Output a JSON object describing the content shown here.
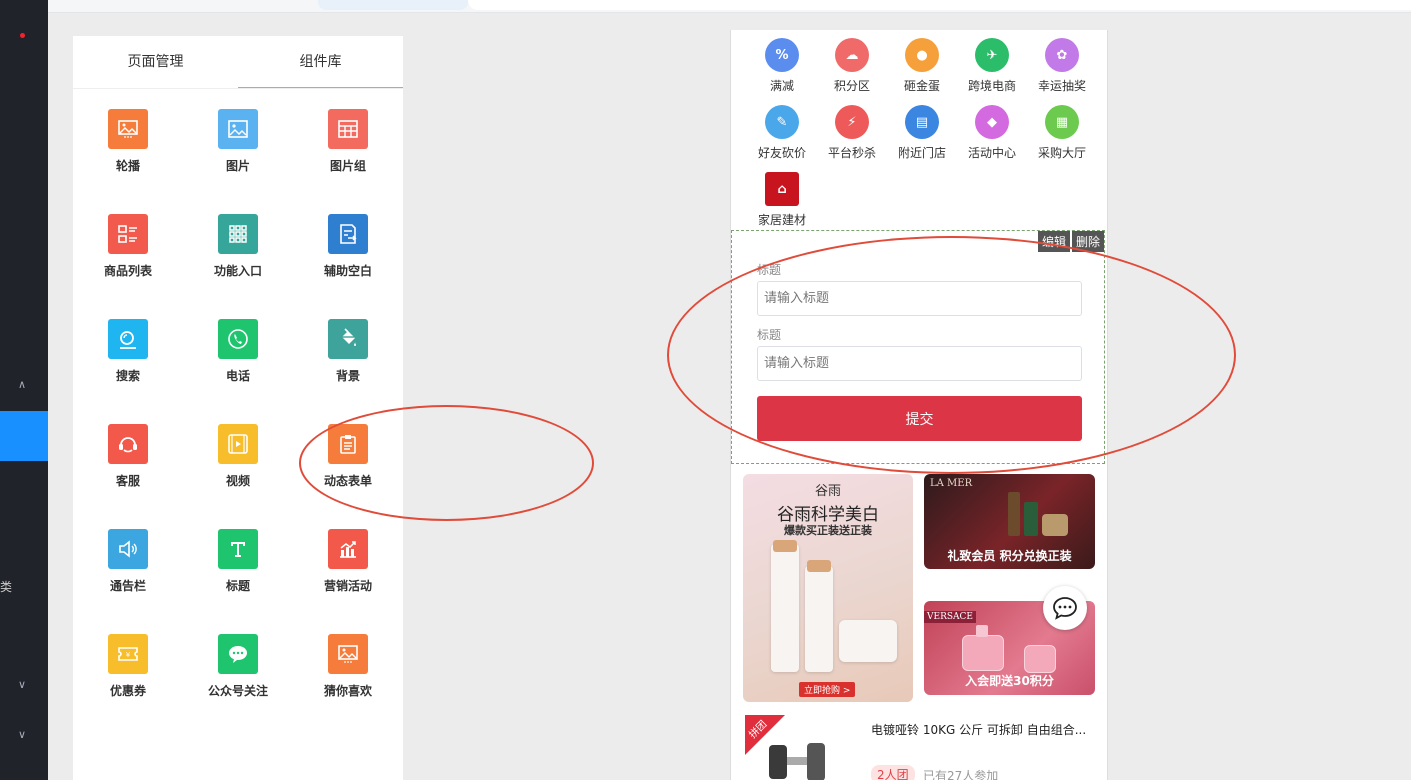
{
  "panel": {
    "tabs": [
      "页面管理",
      "组件库"
    ],
    "components": [
      {
        "label": "轮播",
        "icon": "carousel-icon",
        "color": "#f57c3b"
      },
      {
        "label": "图片",
        "icon": "image-icon",
        "color": "#5ab3f0"
      },
      {
        "label": "图片组",
        "icon": "image-group-icon",
        "color": "#f36b5f"
      },
      {
        "label": "商品列表",
        "icon": "product-list-icon",
        "color": "#f25a4e"
      },
      {
        "label": "功能入口",
        "icon": "grid-entry-icon",
        "color": "#36a69a"
      },
      {
        "label": "辅助空白",
        "icon": "blank-icon",
        "color": "#2f7fd1"
      },
      {
        "label": "搜索",
        "icon": "search-icon",
        "color": "#1eb5f0"
      },
      {
        "label": "电话",
        "icon": "phone-icon",
        "color": "#1ec56e"
      },
      {
        "label": "背景",
        "icon": "paint-bucket-icon",
        "color": "#3ea39b"
      },
      {
        "label": "客服",
        "icon": "headset-icon",
        "color": "#f2594b"
      },
      {
        "label": "视频",
        "icon": "video-icon",
        "color": "#f8bd2a"
      },
      {
        "label": "动态表单",
        "icon": "clipboard-icon",
        "color": "#f57c3b"
      },
      {
        "label": "通告栏",
        "icon": "speaker-icon",
        "color": "#3ba6df"
      },
      {
        "label": "标题",
        "icon": "title-icon",
        "color": "#1ec56e"
      },
      {
        "label": "营销活动",
        "icon": "chart-icon",
        "color": "#f2594b"
      },
      {
        "label": "优惠券",
        "icon": "coupon-icon",
        "color": "#f8bd2a"
      },
      {
        "label": "公众号关注",
        "icon": "wechat-icon",
        "color": "#1ec56e"
      },
      {
        "label": "猜你喜欢",
        "icon": "guess-like-icon",
        "color": "#f57c3b"
      }
    ]
  },
  "phone": {
    "entries": [
      {
        "label": "满减",
        "icon": "discount-icon",
        "color": "#5b8def",
        "glyph": "%"
      },
      {
        "label": "积分区",
        "icon": "points-icon",
        "color": "#f06a6a",
        "glyph": "☁"
      },
      {
        "label": "砸金蛋",
        "icon": "golden-egg-icon",
        "color": "#f5a03a",
        "glyph": "●"
      },
      {
        "label": "跨境电商",
        "icon": "cross-border-icon",
        "color": "#2bbd6a",
        "glyph": "✈"
      },
      {
        "label": "幸运抽奖",
        "icon": "lucky-draw-icon",
        "color": "#c27ae8",
        "glyph": "✿"
      },
      {
        "label": "好友砍价",
        "icon": "bargain-icon",
        "color": "#4aa8ea",
        "glyph": "✎"
      },
      {
        "label": "平台秒杀",
        "icon": "flash-sale-icon",
        "color": "#ee5a5a",
        "glyph": "⚡"
      },
      {
        "label": "附近门店",
        "icon": "store-icon",
        "color": "#3b86e0",
        "glyph": "▤"
      },
      {
        "label": "活动中心",
        "icon": "activity-icon",
        "color": "#d46ae0",
        "glyph": "◆"
      },
      {
        "label": "采购大厅",
        "icon": "purchase-icon",
        "color": "#6cca4e",
        "glyph": "▦"
      },
      {
        "label": "家居建材",
        "icon": "home-building-icon",
        "color": "#c8141f",
        "glyph": "⌂"
      }
    ],
    "form": {
      "edit": "编辑",
      "delete": "删除",
      "fields": [
        {
          "label": "标题",
          "placeholder": "请输入标题"
        },
        {
          "label": "标题",
          "placeholder": "请输入标题"
        }
      ],
      "submit": "提交"
    },
    "banners": {
      "left_brand": "谷雨",
      "left_title": "谷雨科学美白",
      "left_sub": "爆款买正装送正装",
      "left_cta": "立即抢购 >",
      "top_right_brand": "LA MER",
      "top_right": "礼致会员 积分兑换正装",
      "bottom_right_brand": "VERSACE",
      "bottom_right": "入会即送30积分"
    },
    "product": {
      "tag": "拼团",
      "title": "电镀哑铃 10KG 公斤 可拆卸 自由组合...",
      "badge": "2人团",
      "joined": "已有27人参加"
    }
  },
  "sidebar": {
    "partial_label": "类"
  }
}
